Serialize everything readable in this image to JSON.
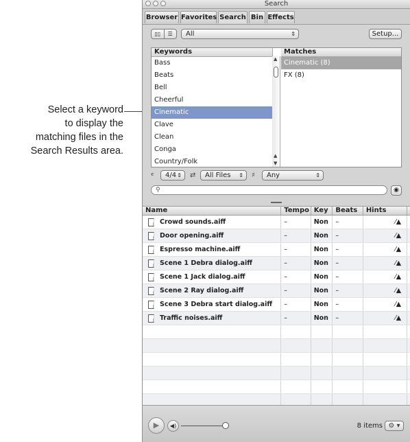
{
  "callout": {
    "lines": [
      "Select a keyword",
      "to display the",
      "matching files in the",
      "Search Results area."
    ]
  },
  "window": {
    "title": "Search",
    "tabs": [
      {
        "label": "Browser",
        "active": false
      },
      {
        "label": "Favorites",
        "active": false
      },
      {
        "label": "Search",
        "active": true
      },
      {
        "label": "Bin",
        "active": false
      },
      {
        "label": "Effects",
        "active": false
      }
    ]
  },
  "toolbar": {
    "keyword_filter_value": "All",
    "setup_label": "Setup..."
  },
  "keywords": {
    "header": "Keywords",
    "items": [
      "Bass",
      "Beats",
      "Bell",
      "Cheerful",
      "Cinematic",
      "Clave",
      "Clean",
      "Conga",
      "Country/Folk"
    ],
    "selected": "Cinematic"
  },
  "matches": {
    "header": "Matches",
    "items": [
      "Cinematic (8)",
      "FX (8)"
    ],
    "selected": "Cinematic (8)"
  },
  "filters": {
    "time_signature": "4/4",
    "file_type": "All Files",
    "scale": "Any"
  },
  "search": {
    "placeholder": ""
  },
  "results": {
    "columns": [
      "Name",
      "Tempo",
      "Key",
      "Beats",
      "Hints"
    ],
    "rows": [
      {
        "name": "Crowd sounds.aiff",
        "tempo": "–",
        "key": "Non",
        "beats": "–"
      },
      {
        "name": "Door opening.aiff",
        "tempo": "–",
        "key": "Non",
        "beats": "–"
      },
      {
        "name": "Espresso machine.aiff",
        "tempo": "–",
        "key": "Non",
        "beats": "–"
      },
      {
        "name": "Scene 1 Debra dialog.aiff",
        "tempo": "–",
        "key": "Non",
        "beats": "–"
      },
      {
        "name": "Scene 1 Jack dialog.aiff",
        "tempo": "–",
        "key": "Non",
        "beats": "–"
      },
      {
        "name": "Scene 2 Ray dialog.aiff",
        "tempo": "–",
        "key": "Non",
        "beats": "–"
      },
      {
        "name": "Scene 3 Debra start dialog.aiff",
        "tempo": "–",
        "key": "Non",
        "beats": "–"
      },
      {
        "name": "Traffic noises.aiff",
        "tempo": "–",
        "key": "Non",
        "beats": "–"
      }
    ],
    "empty_rows": 7
  },
  "footer": {
    "item_count": "8 items"
  },
  "colors": {
    "selection": "#7e97c8",
    "match_selection": "#a6a6a6"
  }
}
